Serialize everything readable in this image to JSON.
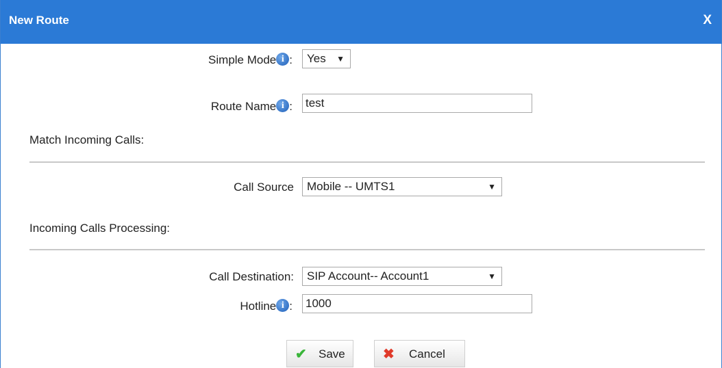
{
  "dialog": {
    "title": "New Route",
    "close_label": "X"
  },
  "form": {
    "simple_mode": {
      "label": "Simple Mode",
      "suffix": ":",
      "value": "Yes"
    },
    "route_name": {
      "label": "Route Name",
      "suffix": ":",
      "value": "test"
    },
    "match_section": "Match Incoming Calls:",
    "call_source": {
      "label": "Call Source",
      "value": "Mobile -- UMTS1"
    },
    "processing_section": "Incoming Calls Processing:",
    "call_destination": {
      "label": "Call Destination:",
      "value": "SIP Account-- Account1"
    },
    "hotline": {
      "label": "Hotline",
      "suffix": ":",
      "value": "1000"
    }
  },
  "buttons": {
    "save_label": "Save",
    "cancel_label": "Cancel"
  },
  "icons": {
    "info": "info-icon",
    "dropdown": "dropdown-arrow-icon",
    "save": "checkmark-icon",
    "cancel": "cross-icon"
  },
  "colors": {
    "titlebar": "#2b7ad6",
    "info_icon": "#2a6fcf",
    "save_check": "#3ab53a",
    "cancel_cross": "#e03a2a"
  }
}
